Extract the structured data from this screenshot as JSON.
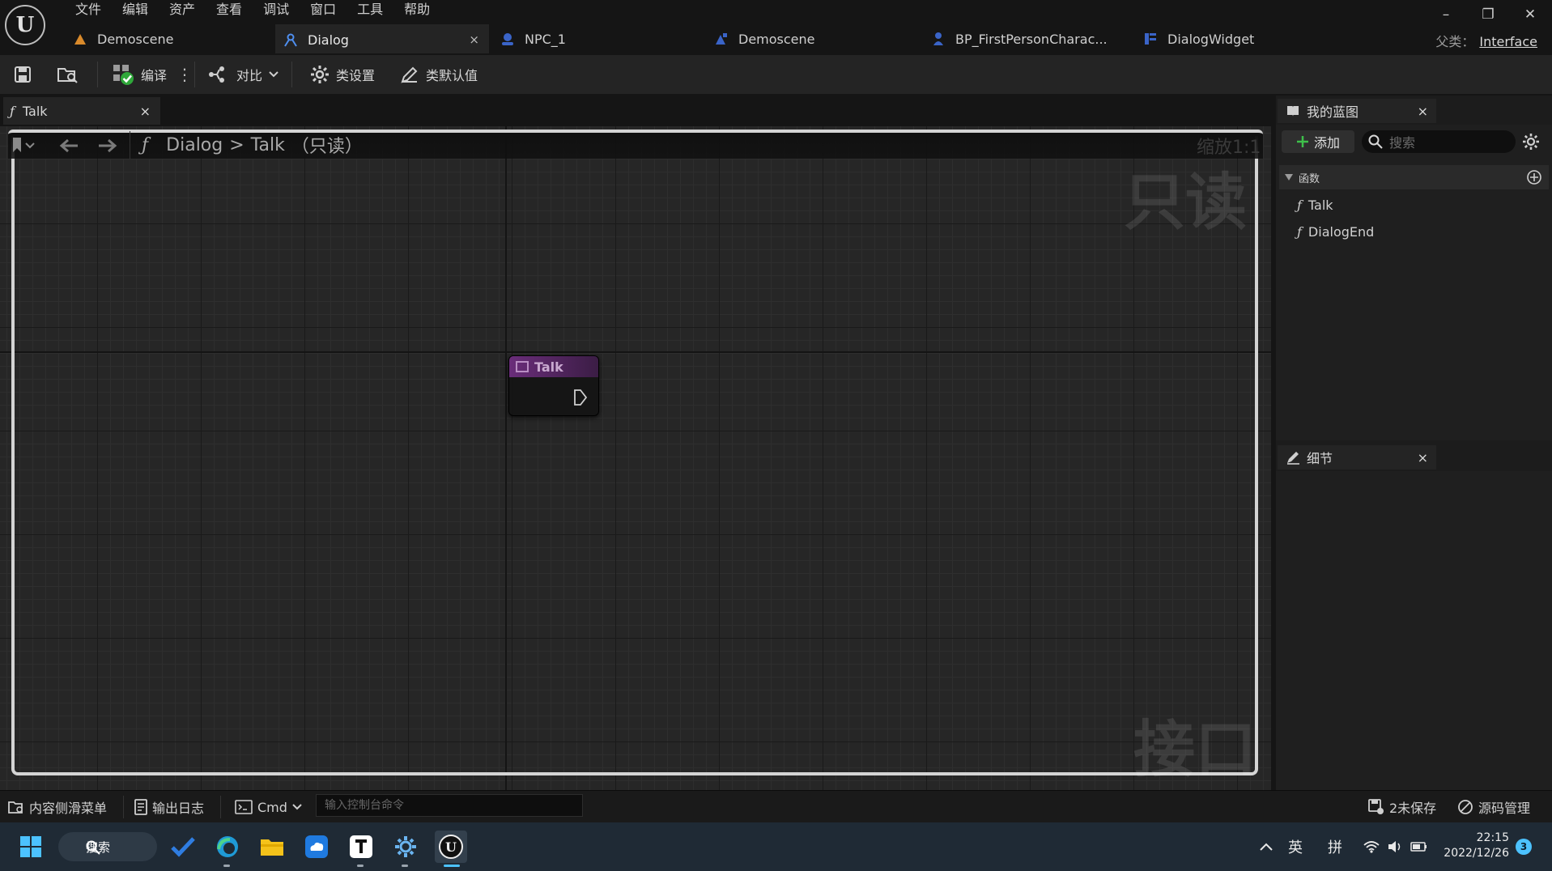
{
  "app": {
    "logo_label": "U"
  },
  "menu": [
    "文件",
    "编辑",
    "资产",
    "查看",
    "调试",
    "窗口",
    "工具",
    "帮助"
  ],
  "doc_tabs": [
    {
      "label": "Demoscene",
      "icon": "level-icon",
      "active": false
    },
    {
      "label": "Dialog",
      "icon": "interface-blueprint-icon",
      "active": true,
      "close": "×"
    },
    {
      "label": "NPC_1",
      "icon": "actor-icon",
      "active": false
    },
    {
      "label": "Demoscene",
      "icon": "level-blueprint-icon",
      "active": false
    },
    {
      "label": "BP_FirstPersonCharac...",
      "icon": "character-icon",
      "active": false
    },
    {
      "label": "DialogWidget",
      "icon": "widget-icon",
      "active": false
    }
  ],
  "parent_class": {
    "label": "父类：",
    "value": "Interface"
  },
  "window_controls": {
    "minimize": "–",
    "restore": "❐",
    "close": "✕"
  },
  "toolbar": {
    "compile": "编译",
    "diff": "对比",
    "class_settings": "类设置",
    "class_defaults": "类默认值"
  },
  "graph": {
    "tab_label": "Talk",
    "tab_close": "×",
    "breadcrumb": {
      "root": "Dialog",
      "separator": ">",
      "current": "Talk",
      "readonly": "（只读）"
    },
    "zoom_label": "缩放1:1",
    "watermark_top": "只读",
    "watermark_bottom": "接口",
    "node_title": "Talk"
  },
  "my_blueprint": {
    "title": "我的蓝图",
    "close": "×",
    "add_label": "添加",
    "search_placeholder": "搜索",
    "category": "函数",
    "functions": [
      "Talk",
      "DialogEnd"
    ]
  },
  "details": {
    "title": "细节",
    "close": "×"
  },
  "status_bar": {
    "content_drawer": "内容侧滑菜单",
    "output_log": "输出日志",
    "cmd": "Cmd",
    "console_placeholder": "输入控制台命令",
    "unsaved": "2未保存",
    "source_control": "源码管理"
  },
  "taskbar": {
    "search": "搜索",
    "tray": {
      "lang1": "英",
      "lang2": "拼",
      "time": "22:15",
      "date": "2022/12/26",
      "notifications": "3"
    }
  },
  "colors": {
    "accent_blue": "#2b7bd8",
    "node_header": "#6a2d7a",
    "background": "#151515"
  }
}
